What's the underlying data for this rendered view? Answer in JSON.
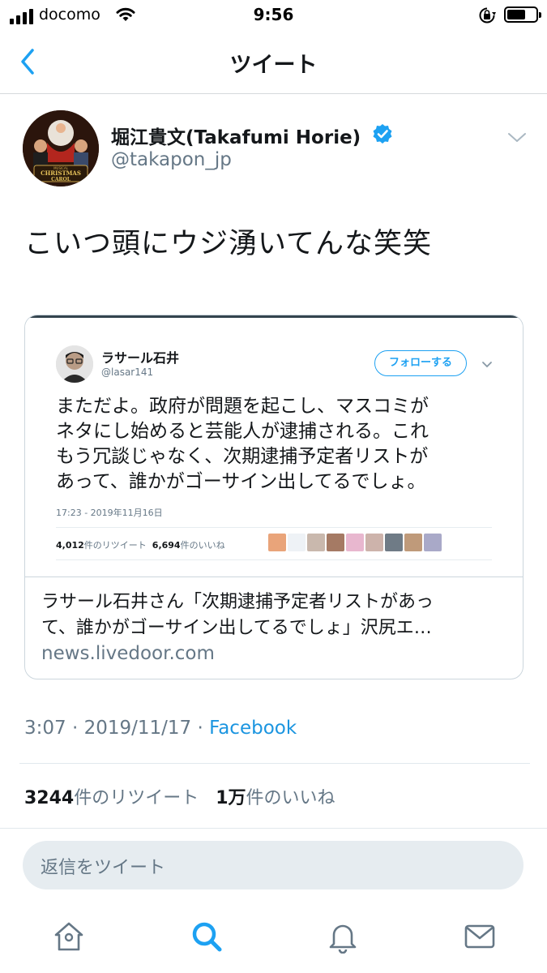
{
  "status_bar": {
    "carrier": "docomo",
    "time": "9:56"
  },
  "nav": {
    "title": "ツイート"
  },
  "author": {
    "display_name": "堀江貴文(Takafumi Horie)",
    "handle": "@takapon_jp",
    "avatar_text": [
      "MUSICAL",
      "CHRISTMAS",
      "CAROL"
    ]
  },
  "tweet": {
    "text": "こいつ頭にウジ湧いてんな笑笑",
    "timestamp": "3:07 · 2019/11/17 · ",
    "source": "Facebook"
  },
  "card": {
    "embedded_tweet": {
      "name": "ラサール石井",
      "handle": "@lasar141",
      "follow_label": "フォローする",
      "lines": [
        "まただよ。政府が問題を起こし、マスコミが",
        "ネタにし始めると芸能人が逮捕される。これ",
        "もう冗談じゃなく、次期逮捕予定者リストが",
        "あって、誰かがゴーサイン出してるでしょ。"
      ],
      "time": "17:23 - 2019年11月16日",
      "retweet_count": "4,012",
      "retweet_label": "件のリツイート",
      "like_count": "6,694",
      "like_label": "件のいいね"
    },
    "title_lines": [
      "ラサール石井さん「次期逮捕予定者リストがあっ",
      "て、誰かがゴーサイン出してるでしょ」沢尻エ…"
    ],
    "domain": "news.livedoor.com"
  },
  "stats": {
    "retweets": "3244",
    "retweets_label": "件のリツイート",
    "likes": "1万",
    "likes_label": "件のいいね"
  },
  "reply": {
    "placeholder": "返信をツイート"
  },
  "tab_bar": {
    "icons": [
      "home-icon",
      "search-icon",
      "notifications-icon",
      "messages-icon"
    ],
    "active": "search-icon"
  },
  "colors": {
    "accent": "#1da1f2",
    "secondary_text": "#657786",
    "link": "#1b95e0"
  }
}
